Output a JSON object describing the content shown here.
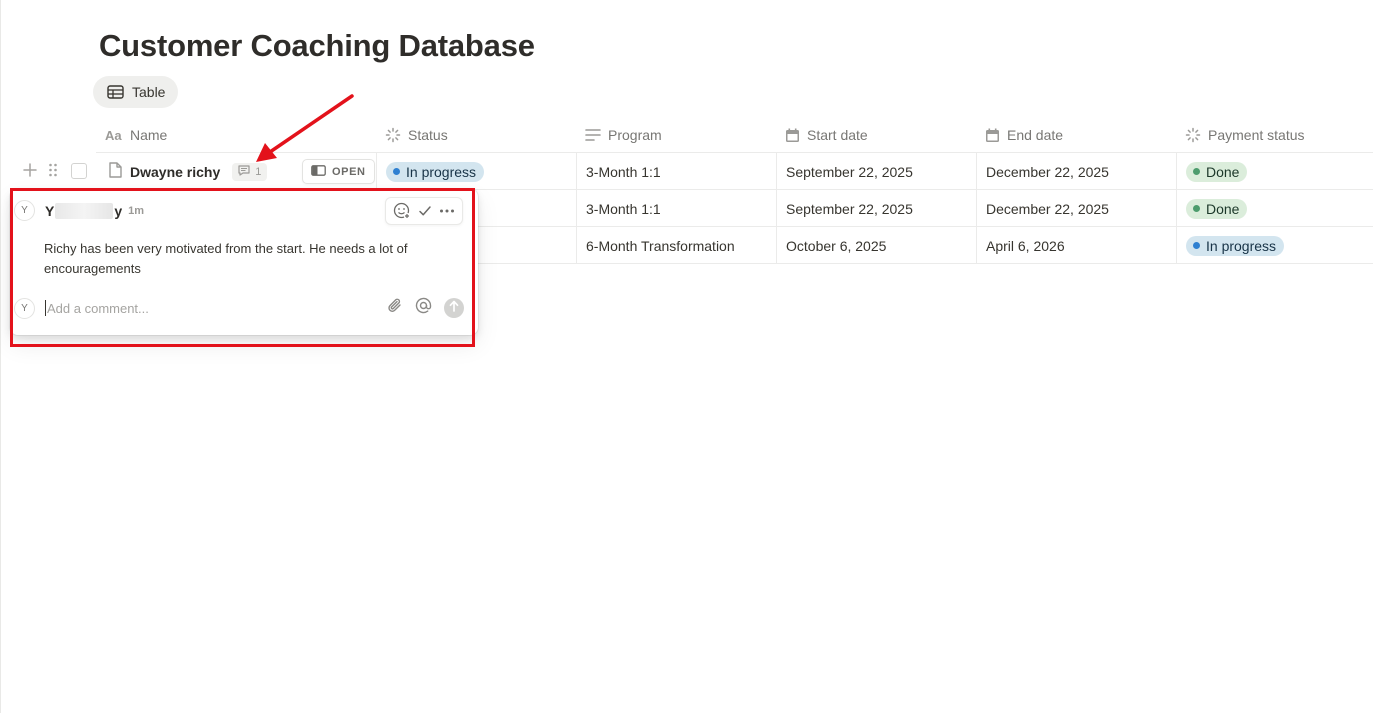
{
  "page": {
    "title": "Customer Coaching Database"
  },
  "view_tab": {
    "label": "Table",
    "icon": "table-icon"
  },
  "columns": [
    {
      "label": "Name",
      "icon": "text-aa-icon"
    },
    {
      "label": "Status",
      "icon": "status-spinner-icon"
    },
    {
      "label": "Program",
      "icon": "text-lines-icon"
    },
    {
      "label": "Start date",
      "icon": "calendar-icon"
    },
    {
      "label": "End date",
      "icon": "calendar-icon"
    },
    {
      "label": "Payment status",
      "icon": "status-spinner-icon"
    }
  ],
  "rows": [
    {
      "name": "Dwayne richy",
      "comment_count": "1",
      "open_label": "OPEN",
      "status": "In progress",
      "program": "3-Month 1:1",
      "start_date": "September 22, 2025",
      "end_date": "December 22, 2025",
      "payment_status": "Done"
    },
    {
      "program": "3-Month 1:1",
      "start_date": "September 22, 2025",
      "end_date": "December 22, 2025",
      "payment_status": "Done"
    },
    {
      "program": "6-Month Transformation",
      "start_date": "October 6, 2025",
      "end_date": "April 6, 2026",
      "payment_status": "In progress"
    }
  ],
  "comment_popup": {
    "author_initial": "Y",
    "author_name_start": "Y",
    "author_name_end": "y",
    "time": "1m",
    "text": "Richy has been very motivated from the start. He needs a lot of encouragements",
    "reply_avatar_initial": "Y",
    "reply_placeholder": "Add a comment..."
  },
  "colors": {
    "in_progress_bg": "#d3e5ef",
    "in_progress_dot": "#2f80d1",
    "done_bg": "#dbeddb",
    "done_dot": "#4d9c6d",
    "annotation_red": "#e3121b"
  }
}
